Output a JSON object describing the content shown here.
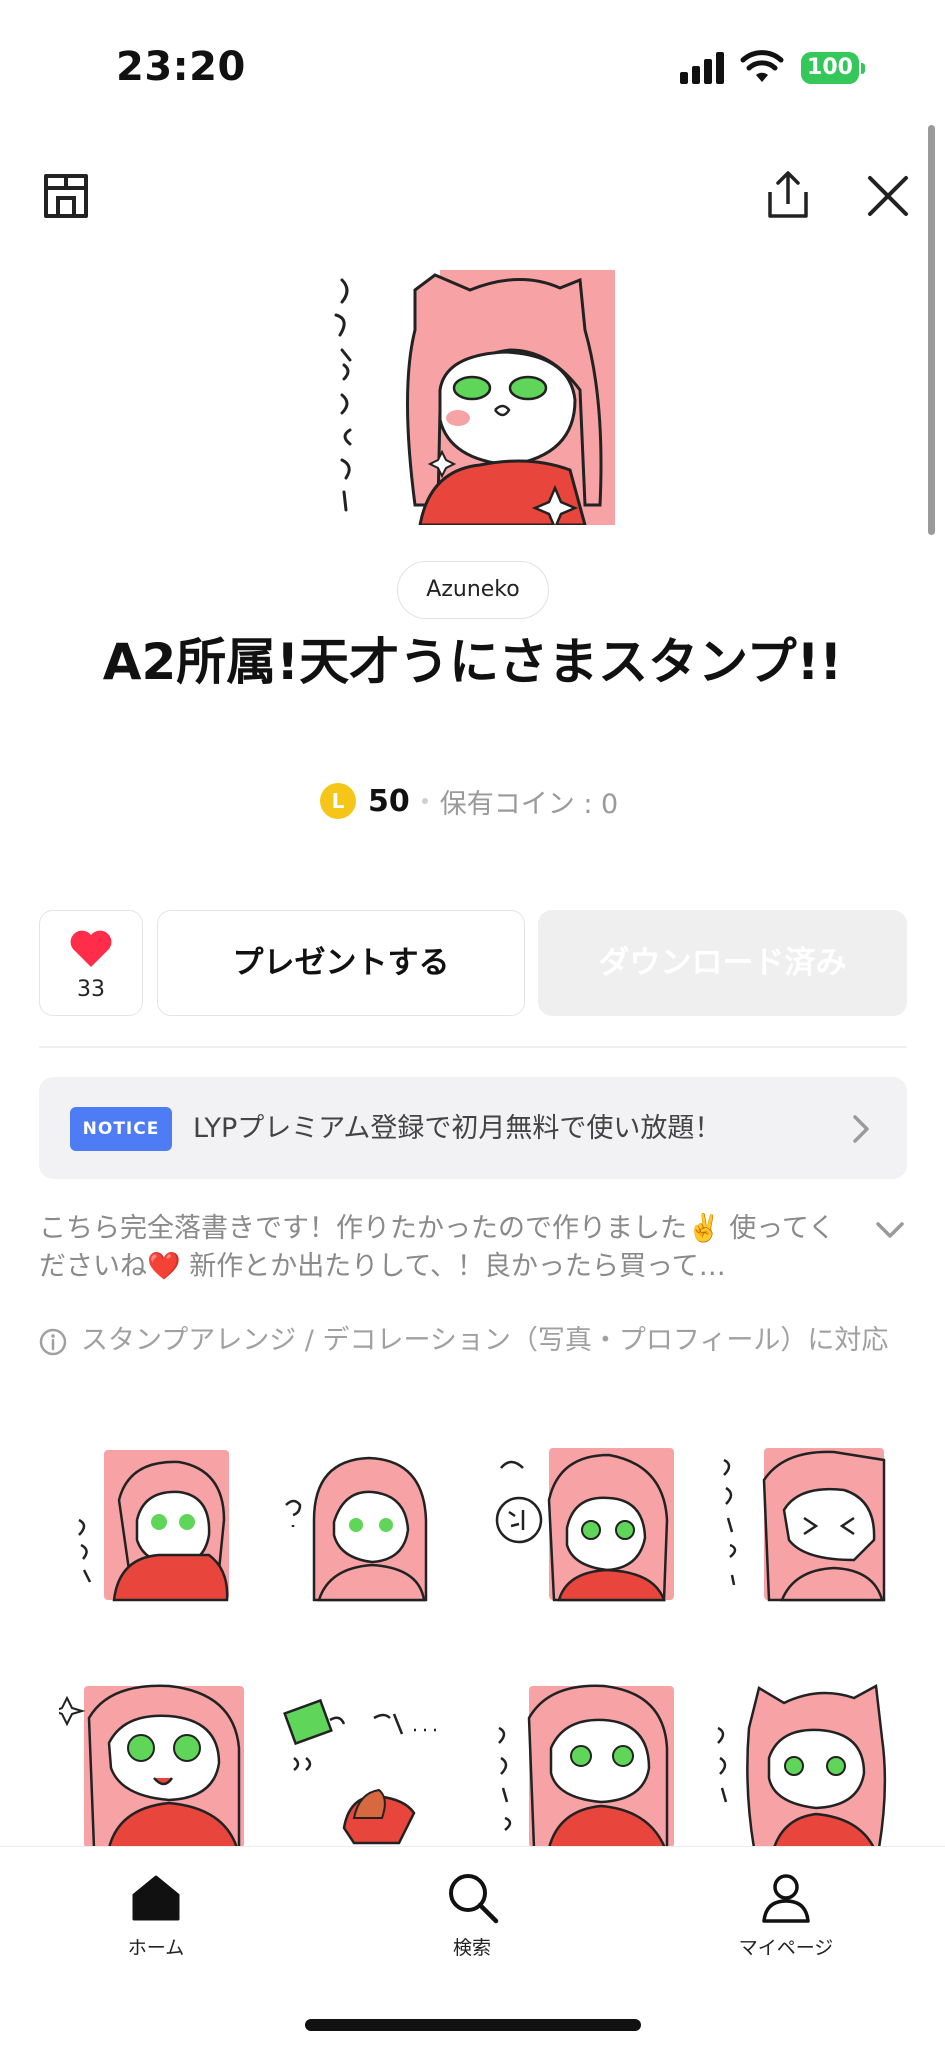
{
  "status_bar": {
    "time": "23:20",
    "battery": "100",
    "battery_color": "#34c759"
  },
  "header": {
    "shop_icon": "shop-icon",
    "share_icon": "share-icon",
    "close_icon": "close-icon"
  },
  "product": {
    "author": "Azuneko",
    "title": "A2所属!天才うにさまスタンプ!!",
    "coin_symbol": "L",
    "price": "50",
    "owned_coins": "保有コイン : 0"
  },
  "actions": {
    "like_count": "33",
    "present_label": "プレゼントする",
    "download_label": "ダウンロード済み"
  },
  "notice": {
    "badge": "NOTICE",
    "text": "LYPプレミアム登録で初月無料で使い放題！",
    "badge_color": "#4d7cf4"
  },
  "description": {
    "text": "こちら完全落書きです！作りたかったので作りました✌️ 使ってくださいね❤️ 新作とか出たりして、！良かったら買って…"
  },
  "info": {
    "text": "スタンプアレンジ / デコレーション（写真・プロフィール）に対応"
  },
  "tabs": [
    {
      "label": "ホーム",
      "icon": "home-icon"
    },
    {
      "label": "検索",
      "icon": "search-icon"
    },
    {
      "label": "マイページ",
      "icon": "person-icon"
    }
  ],
  "colors": {
    "accent_red": "#ff2d4a",
    "sticker_pink": "#f7a3a6",
    "sticker_red": "#e8453c",
    "sticker_green": "#5fd65a"
  }
}
